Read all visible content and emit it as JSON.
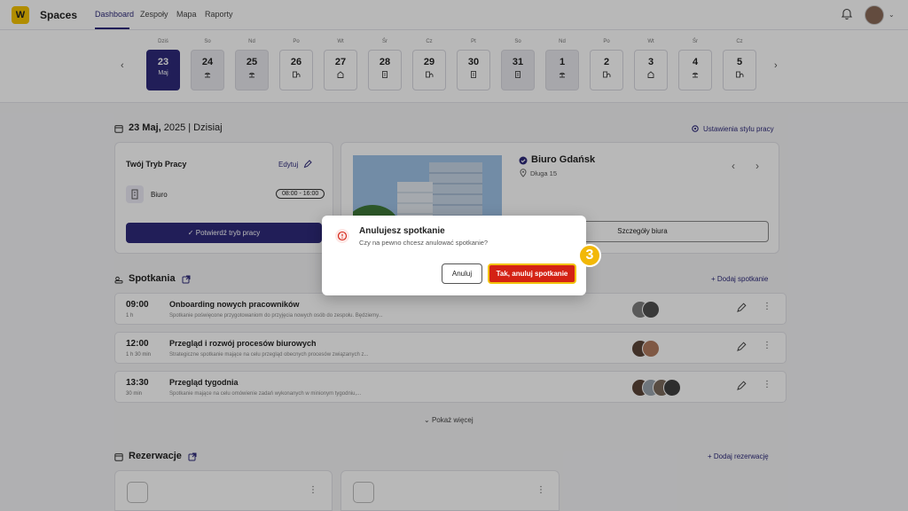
{
  "topnav": {
    "logo_letter": "W",
    "brand": "Spaces",
    "tabs": [
      {
        "label": "Dashboard",
        "active": true
      },
      {
        "label": "Zespoły"
      },
      {
        "label": "Mapa"
      },
      {
        "label": "Raporty"
      }
    ]
  },
  "datestrip": {
    "days": [
      {
        "name": "Dziś",
        "num": "23",
        "sub": "Maj",
        "state": "active",
        "icon": ""
      },
      {
        "name": "So",
        "num": "24",
        "state": "weekend",
        "icon": "beach-icon"
      },
      {
        "name": "Nd",
        "num": "25",
        "state": "weekend",
        "icon": "beach-icon"
      },
      {
        "name": "Po",
        "num": "26",
        "state": "normal",
        "icon": "office-home-icon"
      },
      {
        "name": "Wt",
        "num": "27",
        "state": "normal",
        "icon": "home-icon"
      },
      {
        "name": "Śr",
        "num": "28",
        "state": "normal",
        "icon": "building-icon"
      },
      {
        "name": "Cz",
        "num": "29",
        "state": "normal",
        "icon": "office-home-icon"
      },
      {
        "name": "Pt",
        "num": "30",
        "state": "normal",
        "icon": "building-icon"
      },
      {
        "name": "So",
        "num": "31",
        "state": "weekend",
        "icon": "building-icon"
      },
      {
        "name": "Nd",
        "num": "1",
        "state": "weekend",
        "icon": "beach-icon"
      },
      {
        "name": "Po",
        "num": "2",
        "state": "normal",
        "icon": "office-home-icon"
      },
      {
        "name": "Wt",
        "num": "3",
        "state": "normal",
        "icon": "home-icon"
      },
      {
        "name": "Śr",
        "num": "4",
        "state": "normal",
        "icon": "beach-icon"
      },
      {
        "name": "Cz",
        "num": "5",
        "state": "normal",
        "icon": "office-home-icon"
      }
    ]
  },
  "today": {
    "date_bold": "23 Maj,",
    "date_rest": " 2025 | Dzisiaj",
    "settings_link": "Ustawienia stylu pracy"
  },
  "work_mode": {
    "title": "Twój Tryb Pracy",
    "edit_label": "Edytuj",
    "mode": "Biuro",
    "hours": "08:00 - 16:00",
    "confirm_label": "Potwierdź tryb pracy"
  },
  "office": {
    "name": "Biuro Gdańsk",
    "address": "Długa 15",
    "details_label": "Szczegóły biura"
  },
  "meetings": {
    "title": "Spotkania",
    "add_label": "Dodaj spotkanie",
    "items": [
      {
        "time": "09:00",
        "duration": "1 h",
        "title": "Onboarding nowych pracowników",
        "desc": "Spotkanie poświęcone przygotowaniom do przyjęcia nowych osób do zespołu. Będziemy...",
        "avatars": [
          "#7d7d7d",
          "#4f4f4f"
        ]
      },
      {
        "time": "12:00",
        "duration": "1 h 30 min",
        "title": "Przegląd i rozwój procesów biurowych",
        "desc": "Strategiczne spotkanie mające na celu przegląd obecnych procesów związanych z...",
        "avatars": [
          "#5a4438",
          "#b07a5f"
        ]
      },
      {
        "time": "13:30",
        "duration": "30 min",
        "title": "Przegląd tygodnia",
        "desc": "Spotkanie mające na celu omówienie zadań wykonanych w minionym tygodniu,...",
        "avatars": [
          "#5a4438",
          "#9aa4ae",
          "#7a6a5c",
          "#3f3f3f"
        ]
      }
    ],
    "show_more": "Pokaż więcej"
  },
  "reservations": {
    "title": "Rezerwacje",
    "add_label": "Dodaj rezerwację"
  },
  "modal": {
    "title": "Anulujesz spotkanie",
    "text": "Czy na pewno chcesz anulować spotkanie?",
    "cancel_label": "Anuluj",
    "confirm_label": "Tak, anuluj spotkanie",
    "step_number": "3"
  },
  "colors": {
    "primary": "#2e2a7a",
    "danger": "#d42214",
    "highlight": "#f2c20a",
    "logo": "#f5c400"
  }
}
